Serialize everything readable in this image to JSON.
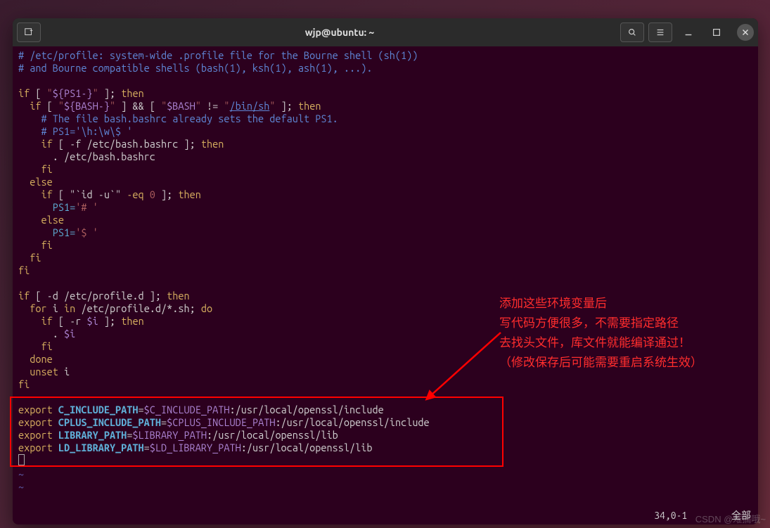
{
  "titlebar": {
    "title": "wjp@ubuntu: ~"
  },
  "code": {
    "l1a": "# /etc/profile: system-wide .profile file for the Bourne shell (sh(1))",
    "l2a": "# and Bourne compatible shells (bash(1), ksh(1), ash(1), ...).",
    "if1": "if",
    "lb": " [ ",
    "q": "\"",
    "ps1v": "${PS1-}",
    "rb": " ]; ",
    "then": "then",
    "bashv": "${BASH-}",
    "amp": " ] && [ ",
    "bashvar": "$BASH",
    "neq": " != ",
    "binsh": "/bin/sh",
    "comm3": "# The file bash.bashrc already sets the default PS1.",
    "comm4": "# PS1='\\h:\\w\\$ '",
    "dashf": " [ -f /etc/bash.bashrc ]; ",
    "dotbash": ". /etc/bash.bashrc",
    "fi": "fi",
    "else": "else",
    "idu": " [ \"`id -u`\" ",
    "eq": "-eq",
    "zero": "0",
    "rb2": " ]; ",
    "ps1eq": "PS1=",
    "hash": "'# '",
    "dollar": "'$ '",
    "dashd": " [ -d /etc/profile.d ]; ",
    "for": "for",
    "iin": " i ",
    "in": "in",
    "glob": " /etc/profile.d/*.sh; ",
    "do": "do",
    "dashr": " [ -r ",
    "ivar": "$i",
    "dot": ". ",
    "done": "done",
    "unset": "unset",
    "unseti": " i",
    "export": "export",
    "cinc": "C_INCLUDE_PATH",
    "eq2": "=",
    "cincv": "$C_INCLUDE_PATH",
    "cincp": ":/usr/local/openssl/include",
    "cplus": "CPLUS_INCLUDE_PATH",
    "cplusv": "$CPLUS_INCLUDE_PATH",
    "lib": "LIBRARY_PATH",
    "libv": "$LIBRARY_PATH",
    "libp": ":/usr/local/openssl/lib",
    "ldlib": "LD_LIBRARY_PATH",
    "ldlibv": "$LD_LIBRARY_PATH",
    "tilde": "~"
  },
  "annotation": {
    "l1": "添加这些环境变量后",
    "l2": "写代码方便很多，不需要指定路径",
    "l3": "去找头文件，库文件就能编译通过！",
    "l4": "（修改保存后可能需要重启系统生效）"
  },
  "status": {
    "pos": "34,0-1",
    "mode": "全部"
  },
  "watermark": "CSDN @难搞哦~"
}
